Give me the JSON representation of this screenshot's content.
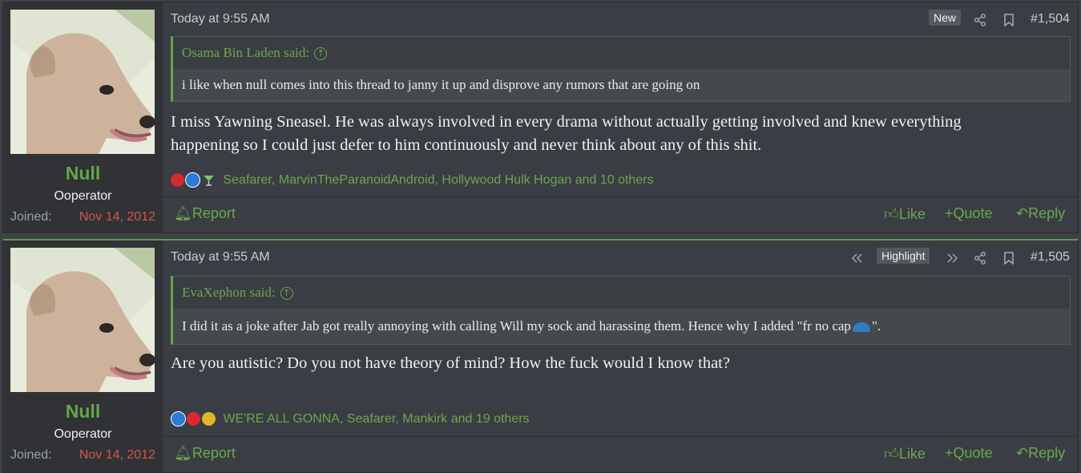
{
  "posts": [
    {
      "author": "Null",
      "user_title": "Ooperator",
      "joined_label": "Joined:",
      "joined_date": "Nov 14, 2012",
      "time": "Today at 9:55 AM",
      "badge": "New",
      "post_number": "#1,504",
      "quote_author": "Osama Bin Laden said:",
      "quote_text": "i like when null comes into this thread to janny it up and disprove any rumors that are going on",
      "message_line1": "I miss Yawning Sneasel. He was always involved in every drama without actually getting involved and knew everything",
      "message_line2": "happening so I could just defer to him continuously and never think about any of this shit.",
      "reactions_text": "Seafarer, MarvinTheParanoidAndroid, Hollywood Hulk Hogan and 10 others",
      "report_label": "Report",
      "like_label": "Like",
      "quote_label": "Quote",
      "reply_label": "Reply"
    },
    {
      "author": "Null",
      "user_title": "Ooperator",
      "joined_label": "Joined:",
      "joined_date": "Nov 14, 2012",
      "time": "Today at 9:55 AM",
      "badge": "Highlight",
      "post_number": "#1,505",
      "quote_author": "EvaXephon said:",
      "quote_text": "I did it as a joke after Jab got really annoying with calling Will my sock and harassing them. Hence why I added \"fr no cap",
      "quote_text_end": "\".",
      "message_line1": "Are you autistic? Do you not have theory of mind? How the fuck would I know that?",
      "reactions_text": "WE'RE ALL GONNA, Seafarer, Mankirk and 19 others",
      "report_label": "Report",
      "like_label": "Like",
      "quote_label": "Quote",
      "reply_label": "Reply"
    }
  ],
  "colors": {
    "accent": "#64a648",
    "joined_date": "#d3574c",
    "background": "#3a3d43"
  },
  "icons": [
    "share-icon",
    "bookmark-icon",
    "bell-icon",
    "thumbs-up-icon",
    "plus-icon",
    "reply-icon",
    "prev-icon",
    "next-icon",
    "arrow-up-icon"
  ]
}
